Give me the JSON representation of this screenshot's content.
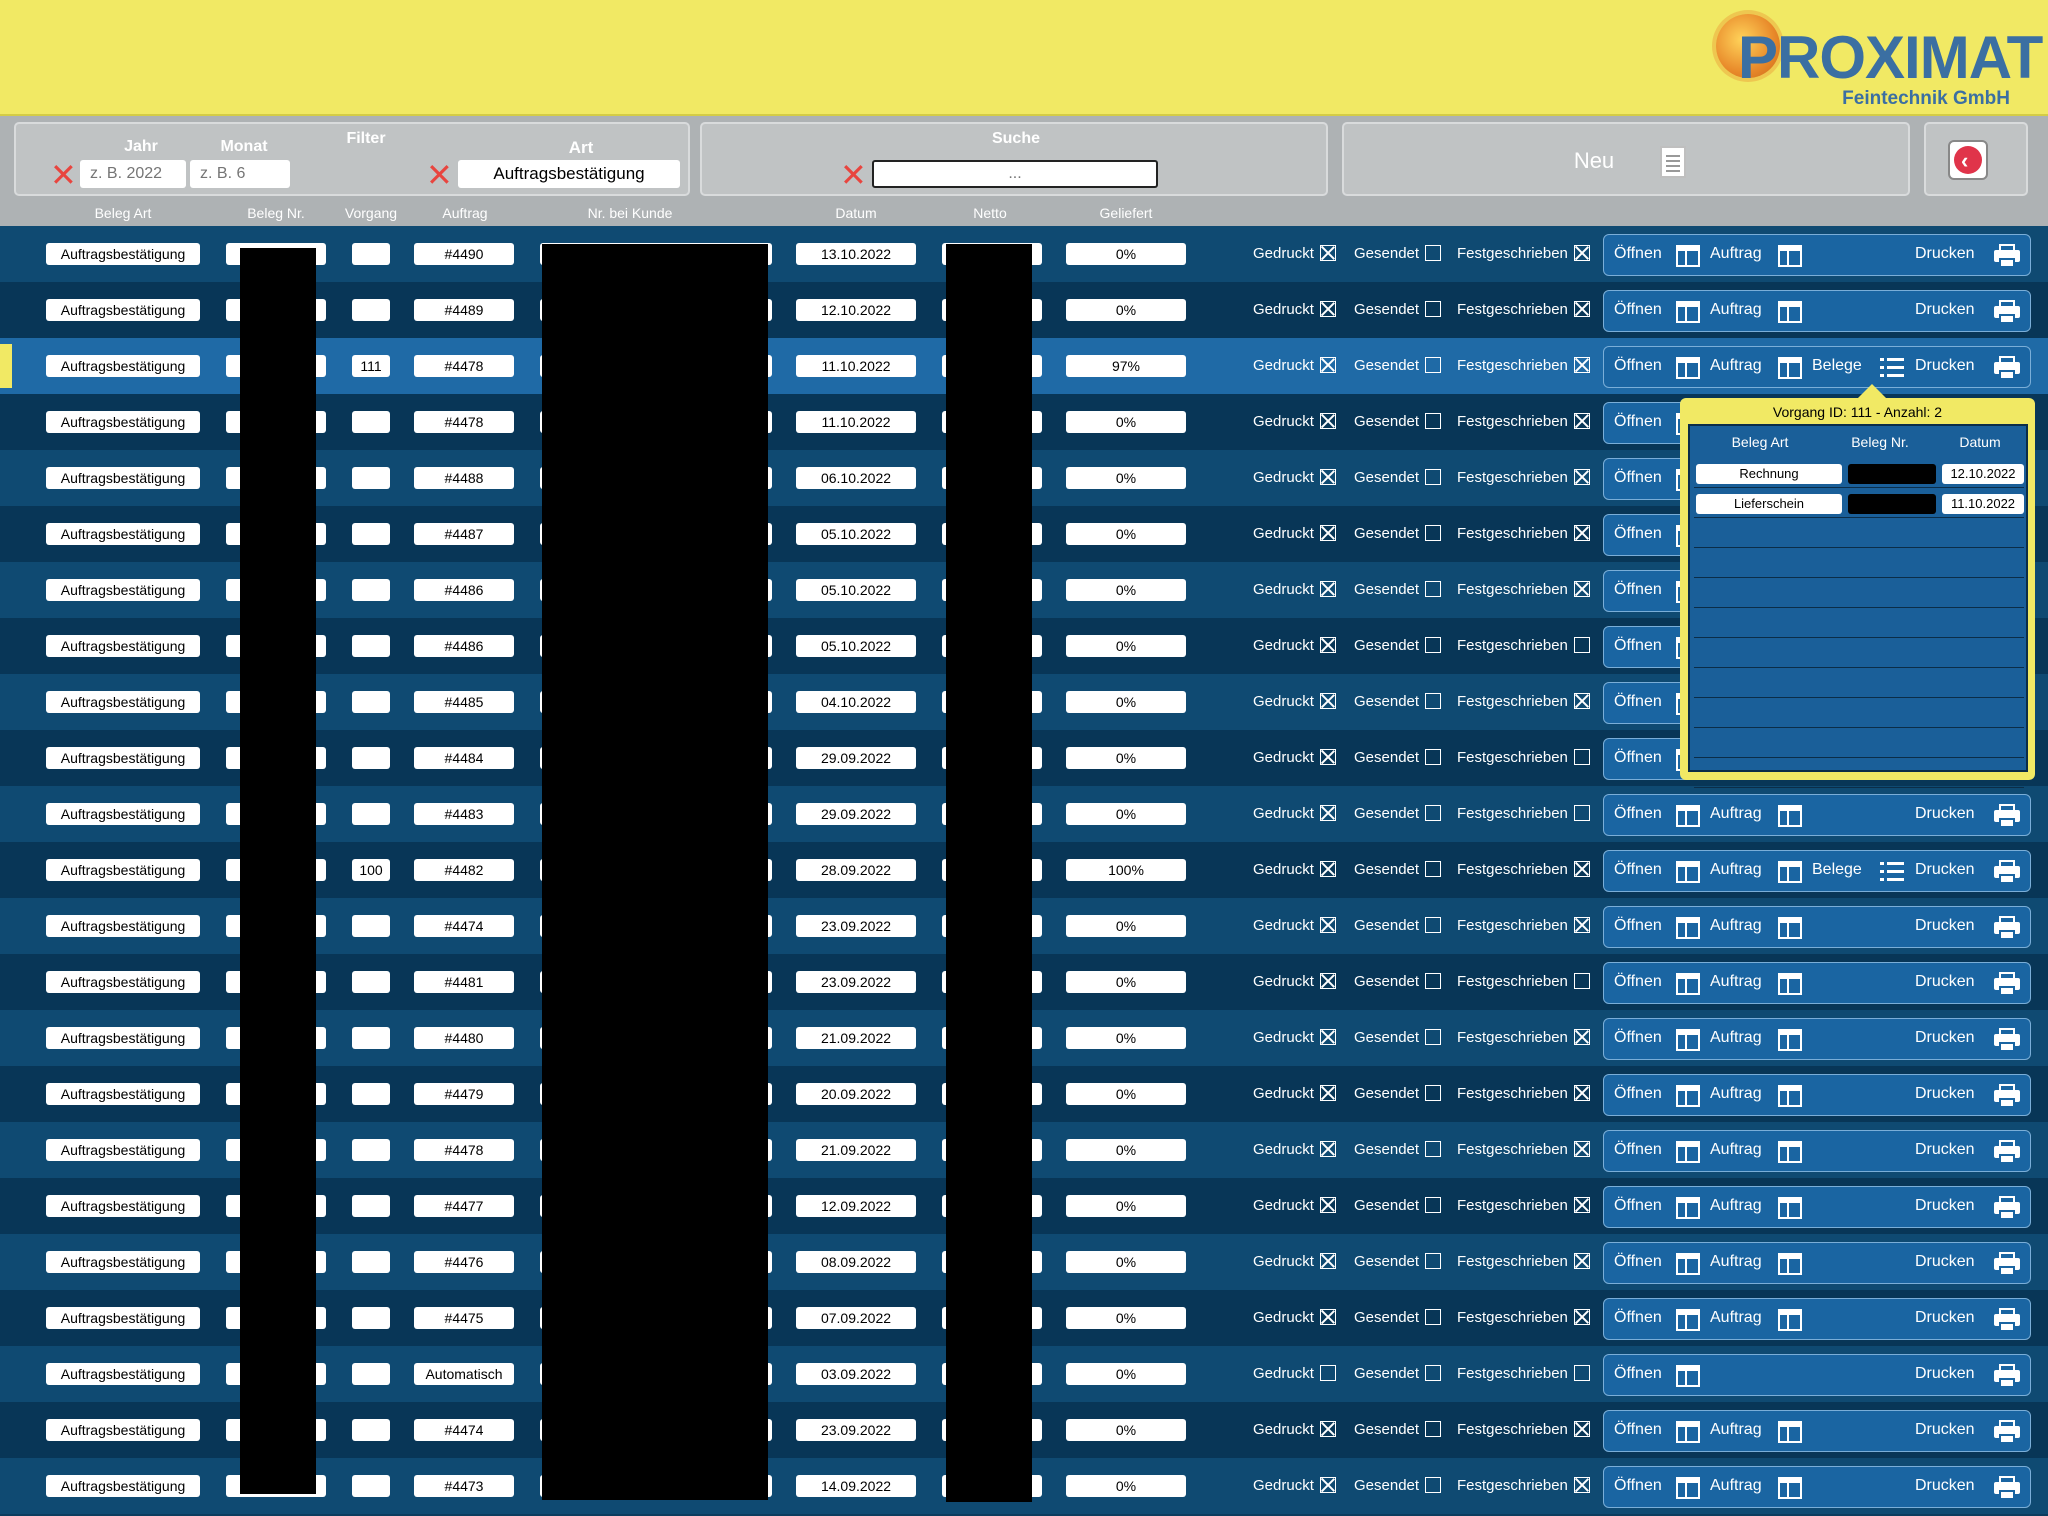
{
  "brand": {
    "name": "PROXIMAT",
    "subtitle": "Feintechnik GmbH"
  },
  "filter": {
    "title": "Filter",
    "jahr_label": "Jahr",
    "jahr_placeholder": "z. B. 2022",
    "monat_label": "Monat",
    "monat_placeholder": "z. B. 6",
    "art_label": "Art",
    "art_value": "Auftragsbestätigung"
  },
  "search": {
    "title": "Suche",
    "placeholder": "..."
  },
  "neu": {
    "label": "Neu"
  },
  "columns": {
    "beleg_art": "Beleg Art",
    "beleg_nr": "Beleg Nr.",
    "vorgang": "Vorgang",
    "auftrag": "Auftrag",
    "nr_kunde": "Nr. bei Kunde",
    "datum": "Datum",
    "netto": "Netto",
    "geliefert": "Geliefert"
  },
  "flags": {
    "gedruckt": "Gedruckt",
    "gesendet": "Gesendet",
    "festgeschrieben": "Festgeschrieben"
  },
  "actions": {
    "oeffnen": "Öffnen",
    "auftrag": "Auftrag",
    "belege": "Belege",
    "drucken": "Drucken"
  },
  "rows": [
    {
      "art": "Auftragsbestätigung",
      "vorgang": "",
      "auftrag": "#4490",
      "datum": "13.10.2022",
      "geliefert": "0%",
      "gedruckt": true,
      "gesendet": false,
      "fest": true,
      "has_auftrag": true,
      "has_belege": false
    },
    {
      "art": "Auftragsbestätigung",
      "vorgang": "",
      "auftrag": "#4489",
      "datum": "12.10.2022",
      "geliefert": "0%",
      "gedruckt": true,
      "gesendet": false,
      "fest": true,
      "has_auftrag": true,
      "has_belege": false
    },
    {
      "art": "Auftragsbestätigung",
      "vorgang": "111",
      "auftrag": "#4478",
      "datum": "11.10.2022",
      "geliefert": "97%",
      "gedruckt": true,
      "gesendet": false,
      "fest": true,
      "has_auftrag": true,
      "has_belege": true,
      "selected": true
    },
    {
      "art": "Auftragsbestätigung",
      "vorgang": "",
      "auftrag": "#4478",
      "datum": "11.10.2022",
      "geliefert": "0%",
      "gedruckt": true,
      "gesendet": false,
      "fest": true,
      "has_auftrag": true,
      "has_belege": false
    },
    {
      "art": "Auftragsbestätigung",
      "vorgang": "",
      "auftrag": "#4488",
      "datum": "06.10.2022",
      "geliefert": "0%",
      "gedruckt": true,
      "gesendet": false,
      "fest": true,
      "has_auftrag": true,
      "has_belege": false
    },
    {
      "art": "Auftragsbestätigung",
      "vorgang": "",
      "auftrag": "#4487",
      "datum": "05.10.2022",
      "geliefert": "0%",
      "gedruckt": true,
      "gesendet": false,
      "fest": true,
      "has_auftrag": true,
      "has_belege": false
    },
    {
      "art": "Auftragsbestätigung",
      "vorgang": "",
      "auftrag": "#4486",
      "datum": "05.10.2022",
      "geliefert": "0%",
      "gedruckt": true,
      "gesendet": false,
      "fest": true,
      "has_auftrag": true,
      "has_belege": false
    },
    {
      "art": "Auftragsbestätigung",
      "vorgang": "",
      "auftrag": "#4486",
      "datum": "05.10.2022",
      "geliefert": "0%",
      "gedruckt": true,
      "gesendet": false,
      "fest": false,
      "has_auftrag": true,
      "has_belege": false
    },
    {
      "art": "Auftragsbestätigung",
      "vorgang": "",
      "auftrag": "#4485",
      "datum": "04.10.2022",
      "geliefert": "0%",
      "gedruckt": true,
      "gesendet": false,
      "fest": true,
      "has_auftrag": true,
      "has_belege": false
    },
    {
      "art": "Auftragsbestätigung",
      "vorgang": "",
      "auftrag": "#4484",
      "datum": "29.09.2022",
      "geliefert": "0%",
      "gedruckt": true,
      "gesendet": false,
      "fest": false,
      "has_auftrag": true,
      "has_belege": false
    },
    {
      "art": "Auftragsbestätigung",
      "vorgang": "",
      "auftrag": "#4483",
      "datum": "29.09.2022",
      "geliefert": "0%",
      "gedruckt": true,
      "gesendet": false,
      "fest": false,
      "has_auftrag": true,
      "has_belege": false
    },
    {
      "art": "Auftragsbestätigung",
      "vorgang": "100",
      "auftrag": "#4482",
      "datum": "28.09.2022",
      "geliefert": "100%",
      "gedruckt": true,
      "gesendet": false,
      "fest": true,
      "has_auftrag": true,
      "has_belege": true
    },
    {
      "art": "Auftragsbestätigung",
      "vorgang": "",
      "auftrag": "#4474",
      "datum": "23.09.2022",
      "geliefert": "0%",
      "gedruckt": true,
      "gesendet": false,
      "fest": true,
      "has_auftrag": true,
      "has_belege": false
    },
    {
      "art": "Auftragsbestätigung",
      "vorgang": "",
      "auftrag": "#4481",
      "datum": "23.09.2022",
      "geliefert": "0%",
      "gedruckt": true,
      "gesendet": false,
      "fest": false,
      "has_auftrag": true,
      "has_belege": false
    },
    {
      "art": "Auftragsbestätigung",
      "vorgang": "",
      "auftrag": "#4480",
      "datum": "21.09.2022",
      "geliefert": "0%",
      "gedruckt": true,
      "gesendet": false,
      "fest": true,
      "has_auftrag": true,
      "has_belege": false
    },
    {
      "art": "Auftragsbestätigung",
      "vorgang": "",
      "auftrag": "#4479",
      "datum": "20.09.2022",
      "geliefert": "0%",
      "gedruckt": true,
      "gesendet": false,
      "fest": true,
      "has_auftrag": true,
      "has_belege": false
    },
    {
      "art": "Auftragsbestätigung",
      "vorgang": "",
      "auftrag": "#4478",
      "datum": "21.09.2022",
      "geliefert": "0%",
      "gedruckt": true,
      "gesendet": false,
      "fest": true,
      "has_auftrag": true,
      "has_belege": false
    },
    {
      "art": "Auftragsbestätigung",
      "vorgang": "",
      "auftrag": "#4477",
      "datum": "12.09.2022",
      "geliefert": "0%",
      "gedruckt": true,
      "gesendet": false,
      "fest": true,
      "has_auftrag": true,
      "has_belege": false
    },
    {
      "art": "Auftragsbestätigung",
      "vorgang": "",
      "auftrag": "#4476",
      "datum": "08.09.2022",
      "geliefert": "0%",
      "gedruckt": true,
      "gesendet": false,
      "fest": true,
      "has_auftrag": true,
      "has_belege": false
    },
    {
      "art": "Auftragsbestätigung",
      "vorgang": "",
      "auftrag": "#4475",
      "datum": "07.09.2022",
      "geliefert": "0%",
      "gedruckt": true,
      "gesendet": false,
      "fest": true,
      "has_auftrag": true,
      "has_belege": false
    },
    {
      "art": "Auftragsbestätigung",
      "vorgang": "",
      "auftrag": "Automatisch",
      "datum": "03.09.2022",
      "geliefert": "0%",
      "gedruckt": false,
      "gesendet": false,
      "fest": false,
      "has_auftrag": false,
      "has_belege": false
    },
    {
      "art": "Auftragsbestätigung",
      "vorgang": "",
      "auftrag": "#4474",
      "datum": "23.09.2022",
      "geliefert": "0%",
      "gedruckt": true,
      "gesendet": false,
      "fest": true,
      "has_auftrag": true,
      "has_belege": false
    },
    {
      "art": "Auftragsbestätigung",
      "vorgang": "",
      "auftrag": "#4473",
      "datum": "14.09.2022",
      "geliefert": "0%",
      "gedruckt": true,
      "gesendet": false,
      "fest": true,
      "has_auftrag": true,
      "has_belege": false
    }
  ],
  "popup": {
    "title": "Vorgang ID: 111 - Anzahl: 2",
    "headers": {
      "beleg_art": "Beleg Art",
      "beleg_nr": "Beleg Nr.",
      "datum": "Datum"
    },
    "items": [
      {
        "art": "Rechnung",
        "datum": "12.10.2022"
      },
      {
        "art": "Lieferschein",
        "datum": "11.10.2022"
      }
    ]
  },
  "colors": {
    "header_yellow": "#f1e964",
    "row_dark": "#083657",
    "row_light": "#0f4a72",
    "row_selected": "#1f6aa6",
    "action_blue": "#1a65a2",
    "clear_red": "#e8453f"
  }
}
